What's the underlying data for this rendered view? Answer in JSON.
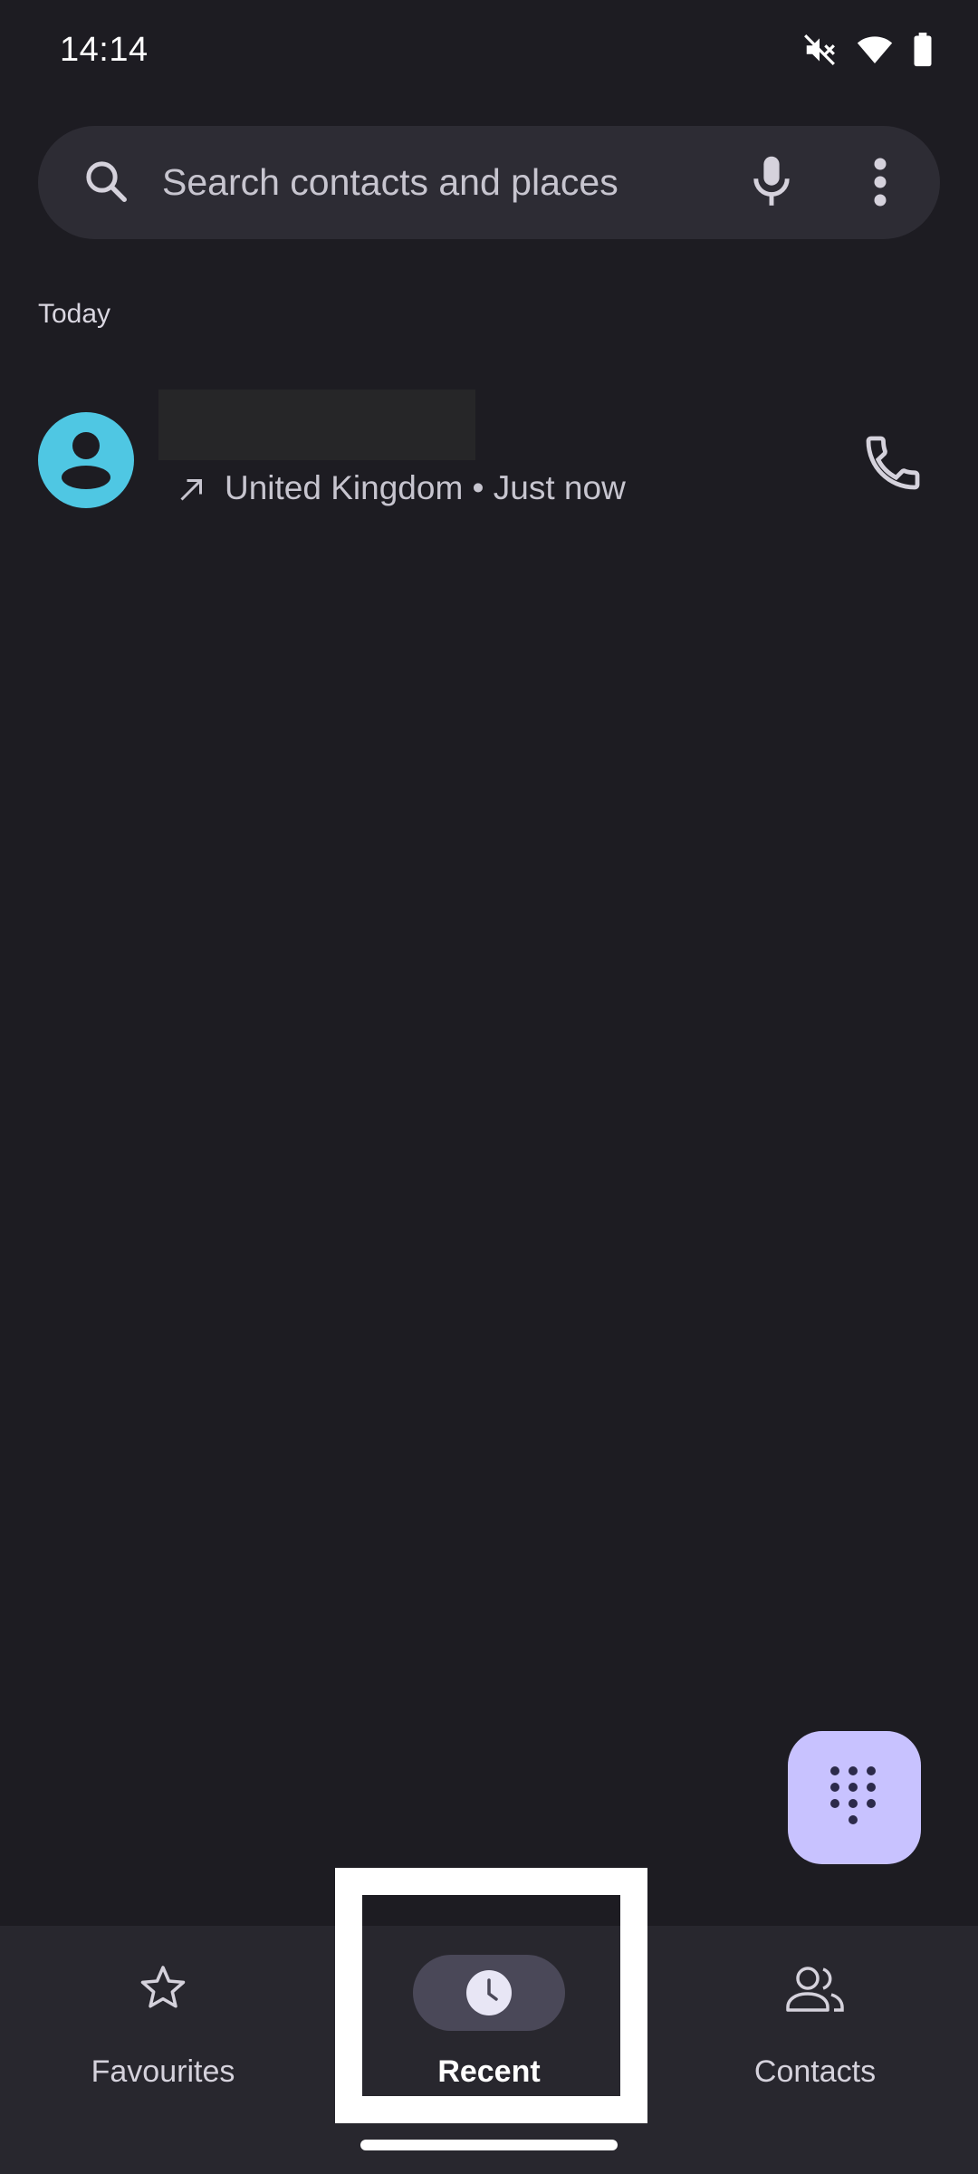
{
  "status_bar": {
    "time": "14:14",
    "icons": [
      "mute-icon",
      "wifi-icon",
      "battery-icon"
    ]
  },
  "search": {
    "placeholder": "Search contacts and places",
    "icons": [
      "search-icon",
      "mic-icon",
      "more-vert-icon"
    ]
  },
  "call_log": {
    "section_header": "Today",
    "entries": [
      {
        "name": "",
        "direction_icon": "outgoing-call-arrow-icon",
        "subtitle": "United Kingdom • Just now",
        "avatar_color": "#4fc7e3",
        "action_icon": "phone-icon"
      }
    ]
  },
  "fab": {
    "icon": "dialpad-icon",
    "color": "#c8c2ff"
  },
  "bottom_nav": {
    "items": [
      {
        "label": "Favourites",
        "icon": "star-icon",
        "active": false
      },
      {
        "label": "Recent",
        "icon": "clock-icon",
        "active": true
      },
      {
        "label": "Contacts",
        "icon": "people-icon",
        "active": false
      }
    ]
  },
  "colors": {
    "background": "#1d1c22",
    "surface": "#28272e",
    "search_bar": "#2d2c34",
    "active_pill": "#4a4858",
    "highlight": "#ffffff"
  }
}
